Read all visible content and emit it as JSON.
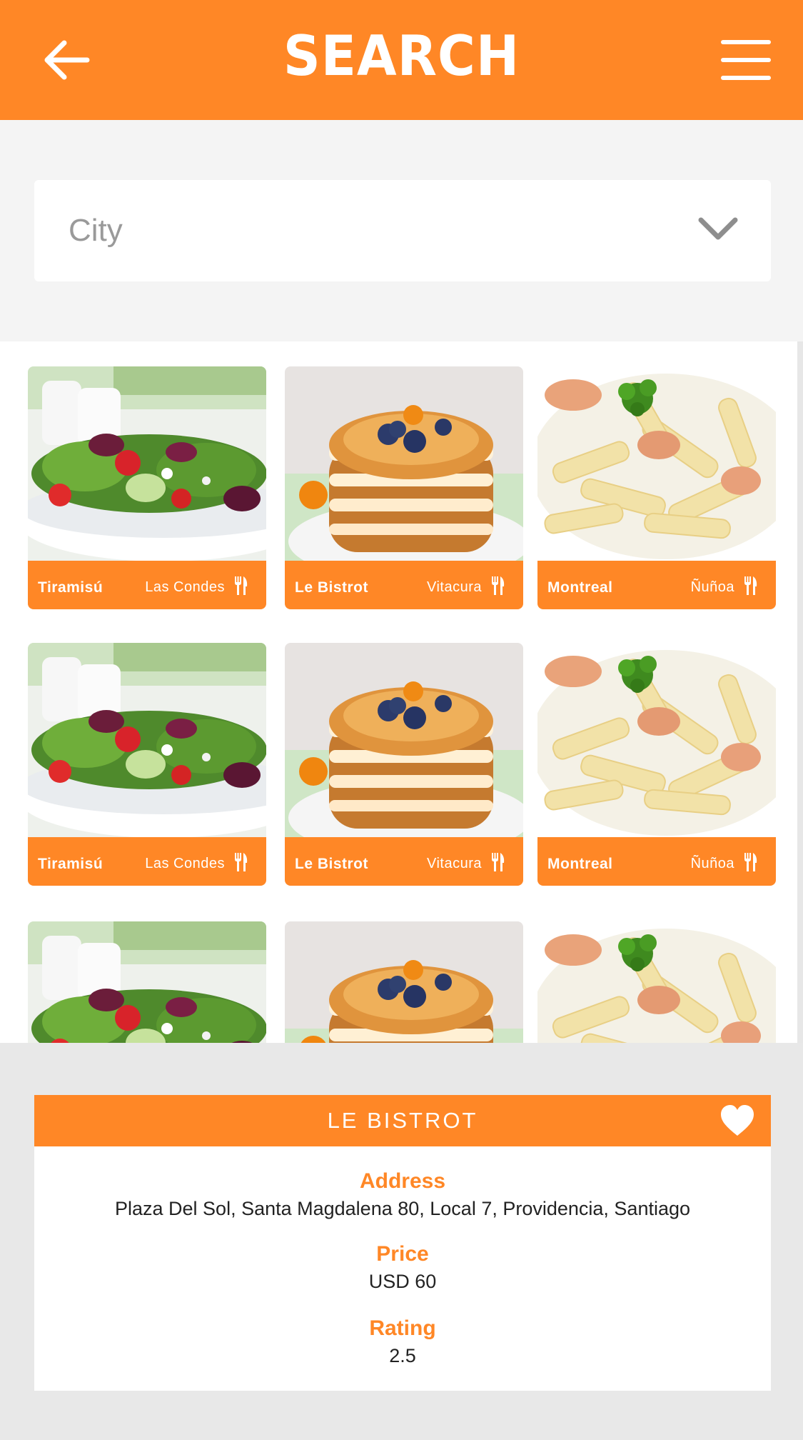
{
  "header": {
    "title": "SEARCH",
    "back_icon": "arrow-left-icon",
    "menu_icon": "hamburger-menu-icon"
  },
  "city_select": {
    "placeholder": "City",
    "icon": "chevron-down-icon"
  },
  "restaurants": [
    {
      "name": "Tiramisú",
      "area": "Las Condes",
      "photo": "salad"
    },
    {
      "name": "Le Bistrot",
      "area": "Vitacura",
      "photo": "pancakes"
    },
    {
      "name": "Montreal",
      "area": "Ñuñoa",
      "photo": "pasta"
    }
  ],
  "detail": {
    "name": "LE BISTROT",
    "favorite_icon": "heart-icon",
    "address_label": "Address",
    "address": "Plaza Del Sol, Santa Magdalena 80, Local 7, Providencia, Santiago",
    "price_label": "Price",
    "price": "USD 60",
    "rating_label": "Rating",
    "rating": "2.5"
  },
  "colors": {
    "accent": "#ff8726",
    "background": "#f4f4f4",
    "panel": "#e8e8e8",
    "text": "#222222"
  }
}
